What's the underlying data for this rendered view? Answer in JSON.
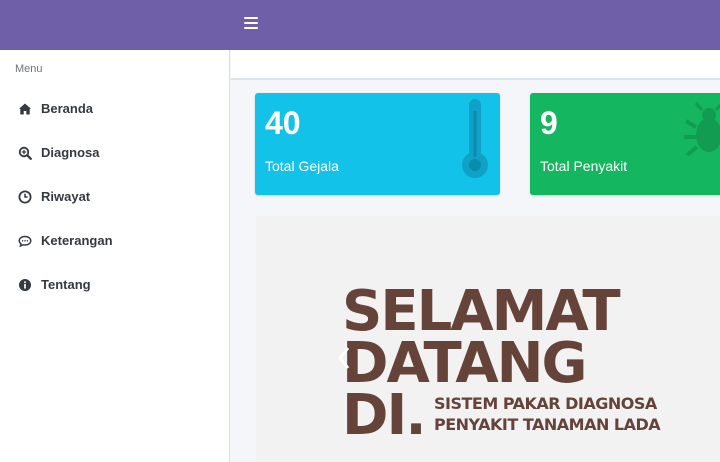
{
  "sidebar": {
    "menu_header": "Menu",
    "items": [
      {
        "label": "Beranda",
        "icon": "home-icon"
      },
      {
        "label": "Diagnosa",
        "icon": "search-plus-icon"
      },
      {
        "label": "Riwayat",
        "icon": "clock-icon"
      },
      {
        "label": "Keterangan",
        "icon": "comment-icon"
      },
      {
        "label": "Tentang",
        "icon": "info-circle-icon"
      }
    ]
  },
  "cards": [
    {
      "value": "40",
      "label": "Total Gejala",
      "icon": "thermometer-icon",
      "color": "#12c2e8"
    },
    {
      "value": "9",
      "label": "Total Penyakit",
      "icon": "bug-icon",
      "color": "#14b65f"
    }
  ],
  "banner": {
    "line1": "SELAMAT",
    "line2": "DATANG",
    "line3": "DI.",
    "sub1": "SISTEM PAKAR DIAGNOSA",
    "sub2": "PENYAKIT TANAMAN LADA"
  },
  "colors": {
    "topbar": "#6f5ea8",
    "banner_text": "#654339"
  }
}
